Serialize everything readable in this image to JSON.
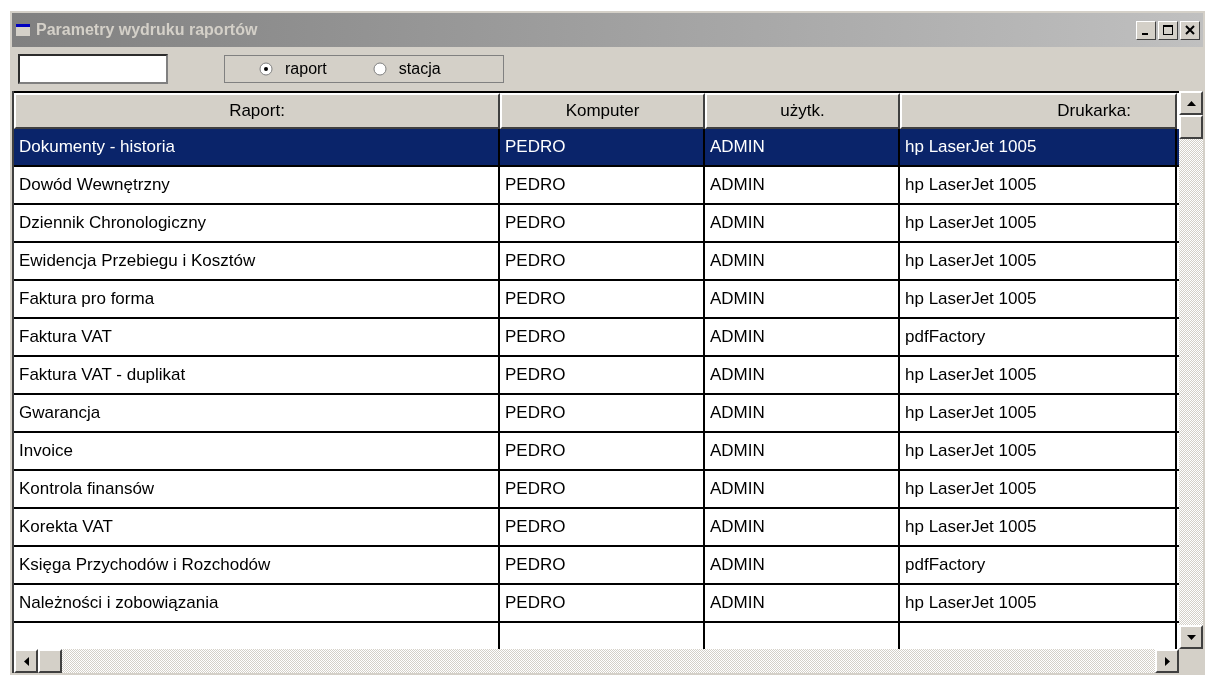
{
  "window": {
    "title": "Parametry wydruku raportów"
  },
  "toolbar": {
    "radios": [
      {
        "label": "raport",
        "selected": true
      },
      {
        "label": "stacja",
        "selected": false
      }
    ]
  },
  "table": {
    "columns": [
      "Raport:",
      "Komputer",
      "użytk.",
      "Drukarka:"
    ],
    "rows": [
      {
        "cells": [
          "Dokumenty - historia",
          "PEDRO",
          "ADMIN",
          "hp LaserJet 1005"
        ],
        "selected": true
      },
      {
        "cells": [
          "Dowód Wewnętrzny",
          "PEDRO",
          "ADMIN",
          "hp LaserJet 1005"
        ],
        "selected": false
      },
      {
        "cells": [
          "Dziennik Chronologiczny",
          "PEDRO",
          "ADMIN",
          "hp LaserJet 1005"
        ],
        "selected": false
      },
      {
        "cells": [
          "Ewidencja Przebiegu i Kosztów",
          "PEDRO",
          "ADMIN",
          "hp LaserJet 1005"
        ],
        "selected": false
      },
      {
        "cells": [
          "Faktura pro forma",
          "PEDRO",
          "ADMIN",
          "hp LaserJet 1005"
        ],
        "selected": false
      },
      {
        "cells": [
          "Faktura VAT",
          "PEDRO",
          "ADMIN",
          "pdfFactory"
        ],
        "selected": false
      },
      {
        "cells": [
          "Faktura VAT - duplikat",
          "PEDRO",
          "ADMIN",
          "hp LaserJet 1005"
        ],
        "selected": false
      },
      {
        "cells": [
          "Gwarancja",
          "PEDRO",
          "ADMIN",
          "hp LaserJet 1005"
        ],
        "selected": false
      },
      {
        "cells": [
          "Invoice",
          "PEDRO",
          "ADMIN",
          "hp LaserJet 1005"
        ],
        "selected": false
      },
      {
        "cells": [
          "Kontrola finansów",
          "PEDRO",
          "ADMIN",
          "hp LaserJet 1005"
        ],
        "selected": false
      },
      {
        "cells": [
          "Korekta VAT",
          "PEDRO",
          "ADMIN",
          "hp LaserJet 1005"
        ],
        "selected": false
      },
      {
        "cells": [
          "Księga Przychodów i Rozchodów",
          "PEDRO",
          "ADMIN",
          "pdfFactory"
        ],
        "selected": false
      },
      {
        "cells": [
          "Należności i zobowiązania",
          "PEDRO",
          "ADMIN",
          "hp LaserJet 1005"
        ],
        "selected": false
      }
    ]
  }
}
